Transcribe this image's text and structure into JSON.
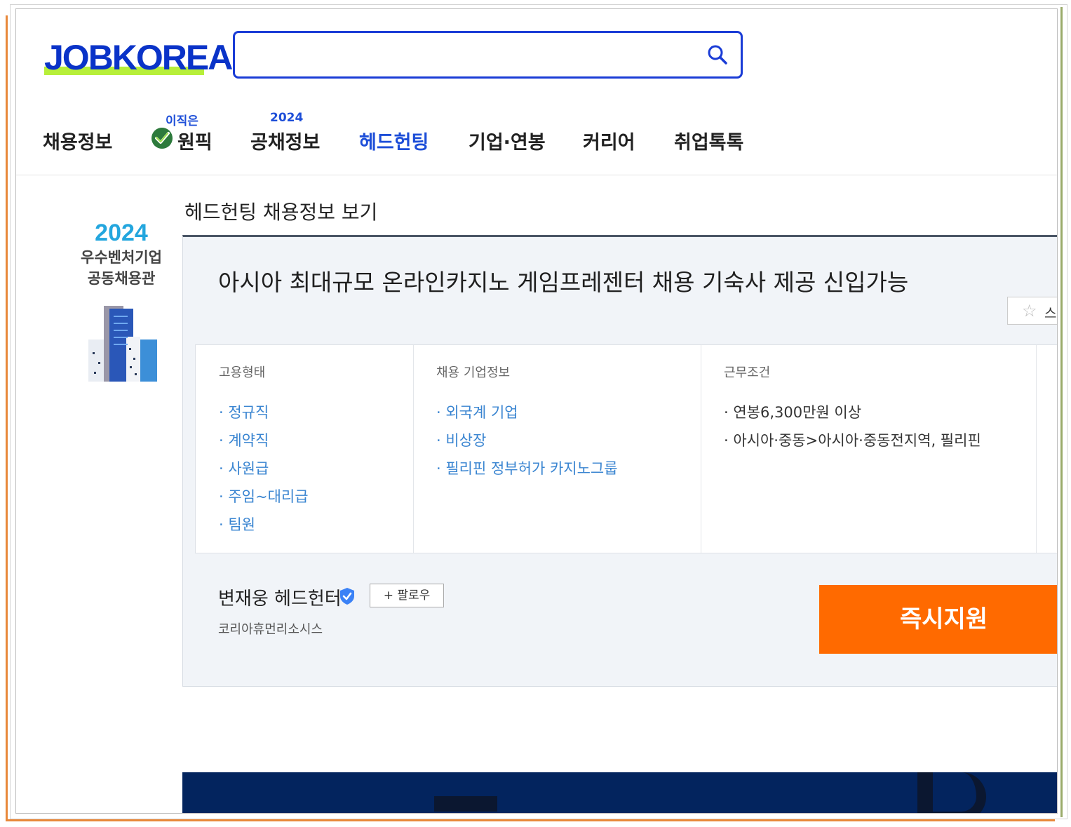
{
  "header": {
    "logo_text": "JOBKOREA",
    "search": {
      "value": "",
      "icon": "search-icon"
    }
  },
  "nav": {
    "items": [
      {
        "label": "채용정보",
        "sup": ""
      },
      {
        "label": "원픽",
        "sup": "이직은",
        "icon": "check-badge-icon"
      },
      {
        "label": "공채정보",
        "sup": "2024"
      },
      {
        "label": "헤드헌팅",
        "sup": "",
        "active": true
      },
      {
        "label": "기업·연봉",
        "sup": ""
      },
      {
        "label": "커리어",
        "sup": ""
      },
      {
        "label": "취업톡톡",
        "sup": ""
      }
    ]
  },
  "side_banner": {
    "year": "2024",
    "line1": "우수벤처기업",
    "line2": "공동채용관"
  },
  "section_title": "헤드헌팅 채용정보 보기",
  "job": {
    "title": "아시아 최대규모 온라인카지노 게임프레젠터 채용 기숙사 제공 신입가능",
    "scrap_label": "스",
    "columns": [
      {
        "heading": "고용형태",
        "items": [
          "· 정규직",
          "· 계약직",
          "· 사원급",
          "· 주임~대리급",
          "· 팀원"
        ]
      },
      {
        "heading": "채용 기업정보",
        "items": [
          "· 외국계 기업",
          "· 비상장",
          "· 필리핀 정부허가 카지노그룹"
        ]
      },
      {
        "heading": "근무조건",
        "items": [
          "· 연봉6,300만원 이상",
          "· 아시아·중동>아시아·중동전지역, 필리핀"
        ]
      }
    ],
    "hunter": {
      "name": "변재웅 헤드헌터",
      "follow_label": "+ 팔로우",
      "company": "코리아휴먼리소시스"
    },
    "apply_label": "즉시지원"
  },
  "colors": {
    "brand_blue": "#0a33c8",
    "logo_highlight": "#b7ef3a",
    "apply_orange": "#ff6a00",
    "link_blue": "#3a85d1",
    "bottom_banner": "#03245e"
  }
}
